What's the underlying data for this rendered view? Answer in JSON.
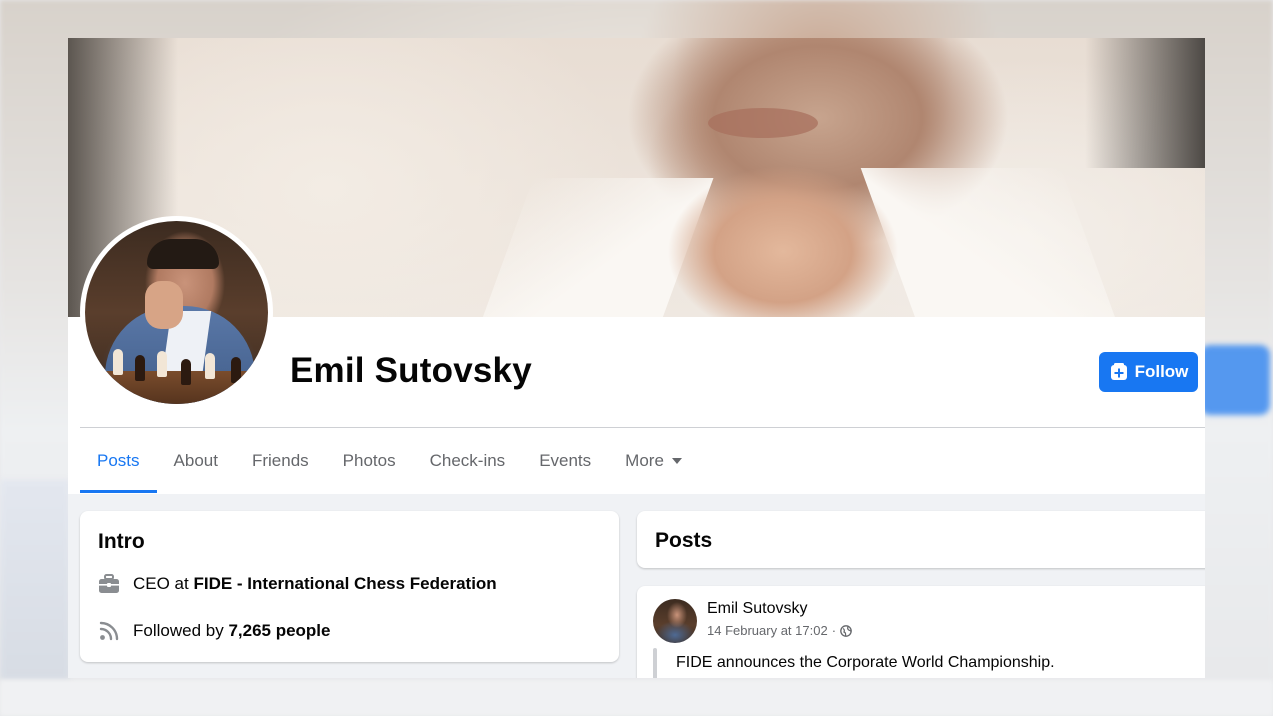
{
  "profile": {
    "name": "Emil Sutovsky",
    "follow_label": "Follow"
  },
  "tabs": [
    {
      "label": "Posts",
      "active": true
    },
    {
      "label": "About"
    },
    {
      "label": "Friends"
    },
    {
      "label": "Photos"
    },
    {
      "label": "Check-ins"
    },
    {
      "label": "Events"
    },
    {
      "label": "More"
    }
  ],
  "intro": {
    "title": "Intro",
    "work_prefix": "CEO at ",
    "work_org": "FIDE - International Chess Federation",
    "followers_prefix": "Followed by ",
    "followers_count": "7,265 people"
  },
  "posts_section": {
    "title": "Posts"
  },
  "post": {
    "author": "Emil Sutovsky",
    "timestamp": "14 February at 17:02",
    "separator": "·",
    "privacy_icon": "globe-icon",
    "text": "FIDE announces the Corporate World Championship."
  },
  "colors": {
    "accent": "#1877f2",
    "text_primary": "#050505",
    "text_secondary": "#65676b",
    "page_bg": "#f0f2f5"
  },
  "icons": {
    "work": "briefcase-icon",
    "followers": "rss-icon",
    "follow": "follow-plus-icon",
    "more": "caret-down-icon"
  }
}
